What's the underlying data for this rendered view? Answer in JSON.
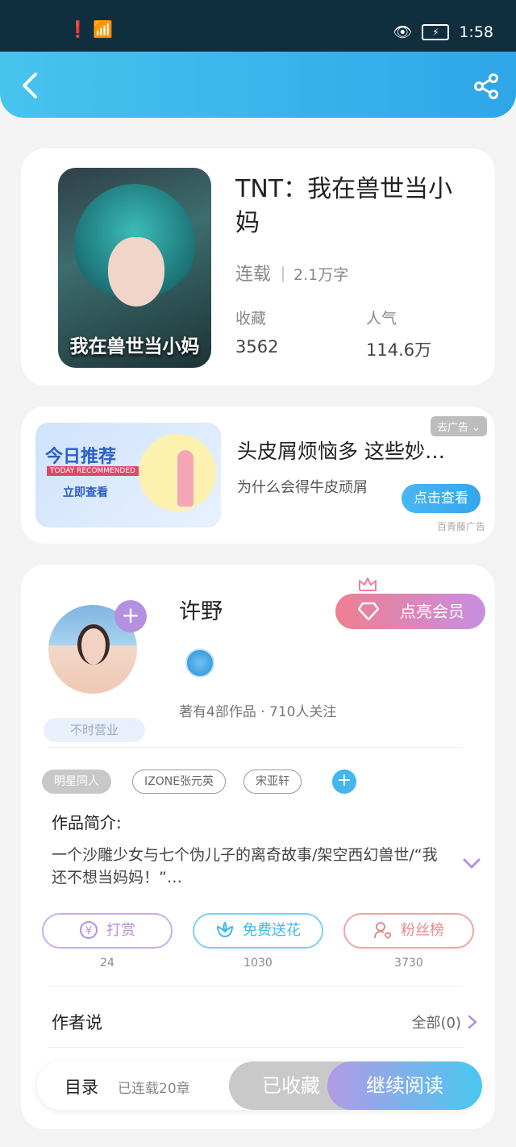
{
  "status_bar": {
    "time": "1:58"
  },
  "book": {
    "title": "TNT：我在兽世当小妈",
    "status": "连载",
    "words": "2.1万字",
    "cover_text": "我在兽世当小妈",
    "stats": [
      {
        "label": "收藏",
        "value": "3562"
      },
      {
        "label": "人气",
        "value": "114.6万"
      }
    ]
  },
  "ad": {
    "image_title": "今日推荐",
    "image_subtitle": "TODAY RECOMMENDED",
    "image_cta": "立即查看",
    "close_label": "去广告",
    "title": "头皮屑烦恼多 这些妙…",
    "desc": "为什么会得牛皮顽屑",
    "button": "点击查看",
    "source": "百青藤广告"
  },
  "author": {
    "name": "许野",
    "badge": "不时营业",
    "vip_button": "点亮会员",
    "stats": "著有4部作品 · 710人关注"
  },
  "tags": [
    "明星同人",
    "IZONE张元英",
    "宋亚轩"
  ],
  "intro": {
    "label": "作品简介:",
    "text": "一个沙雕少女与七个伪儿子的离奇故事/架空西幻兽世/“我还不想当妈妈！”…"
  },
  "actions": [
    {
      "label": "打赏",
      "count": "24",
      "color": "#b58fe0"
    },
    {
      "label": "免费送花",
      "count": "1030",
      "color": "#43b6ee"
    },
    {
      "label": "粉丝榜",
      "count": "3730",
      "color": "#e88a8a"
    }
  ],
  "author_says": {
    "label": "作者说",
    "all": "全部(0)"
  },
  "bottom_bar": {
    "toc": "目录",
    "chapters": "已连载20章",
    "collected": "已收藏",
    "continue": "继续阅读"
  }
}
